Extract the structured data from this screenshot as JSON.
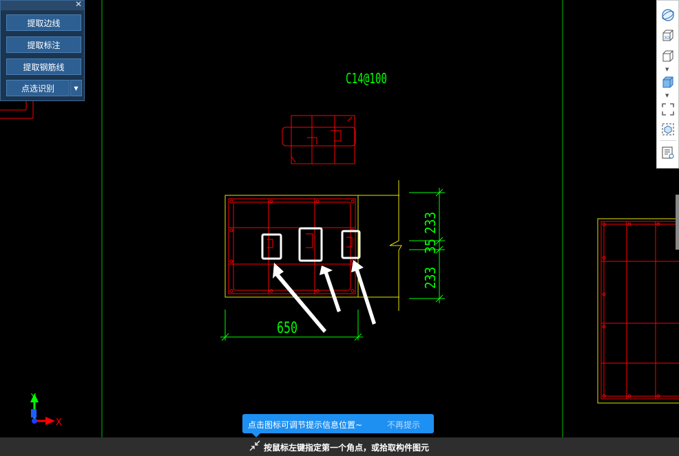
{
  "panel": {
    "buttons": [
      {
        "label": "提取边线"
      },
      {
        "label": "提取标注"
      },
      {
        "label": "提取钢筋线"
      },
      {
        "label": "点选识别"
      }
    ]
  },
  "drawing": {
    "rebar_label": "C14@100",
    "dim_width": "650",
    "dim_top": "233",
    "dim_mid": "35",
    "dim_bottom": "233",
    "axis_x": "X",
    "axis_y": "Y"
  },
  "toolbar": {
    "icons": [
      "orbit-icon",
      "3d-view-icon",
      "box-view-icon",
      "solid-box-icon",
      "fit-frame-icon",
      "component-icon",
      "properties-icon"
    ]
  },
  "tooltip": {
    "message": "点击图标可调节提示信息位置~",
    "dismiss": "不再提示"
  },
  "status": {
    "prompt": "按鼠标左键指定第一个角点，或拾取构件图元"
  },
  "colors": {
    "background": "#000000",
    "rebar": "#ff0000",
    "outline": "#ffff00",
    "dimension": "#00ff00",
    "highlight": "#ffffff",
    "tooltip": "#1e90f2"
  }
}
